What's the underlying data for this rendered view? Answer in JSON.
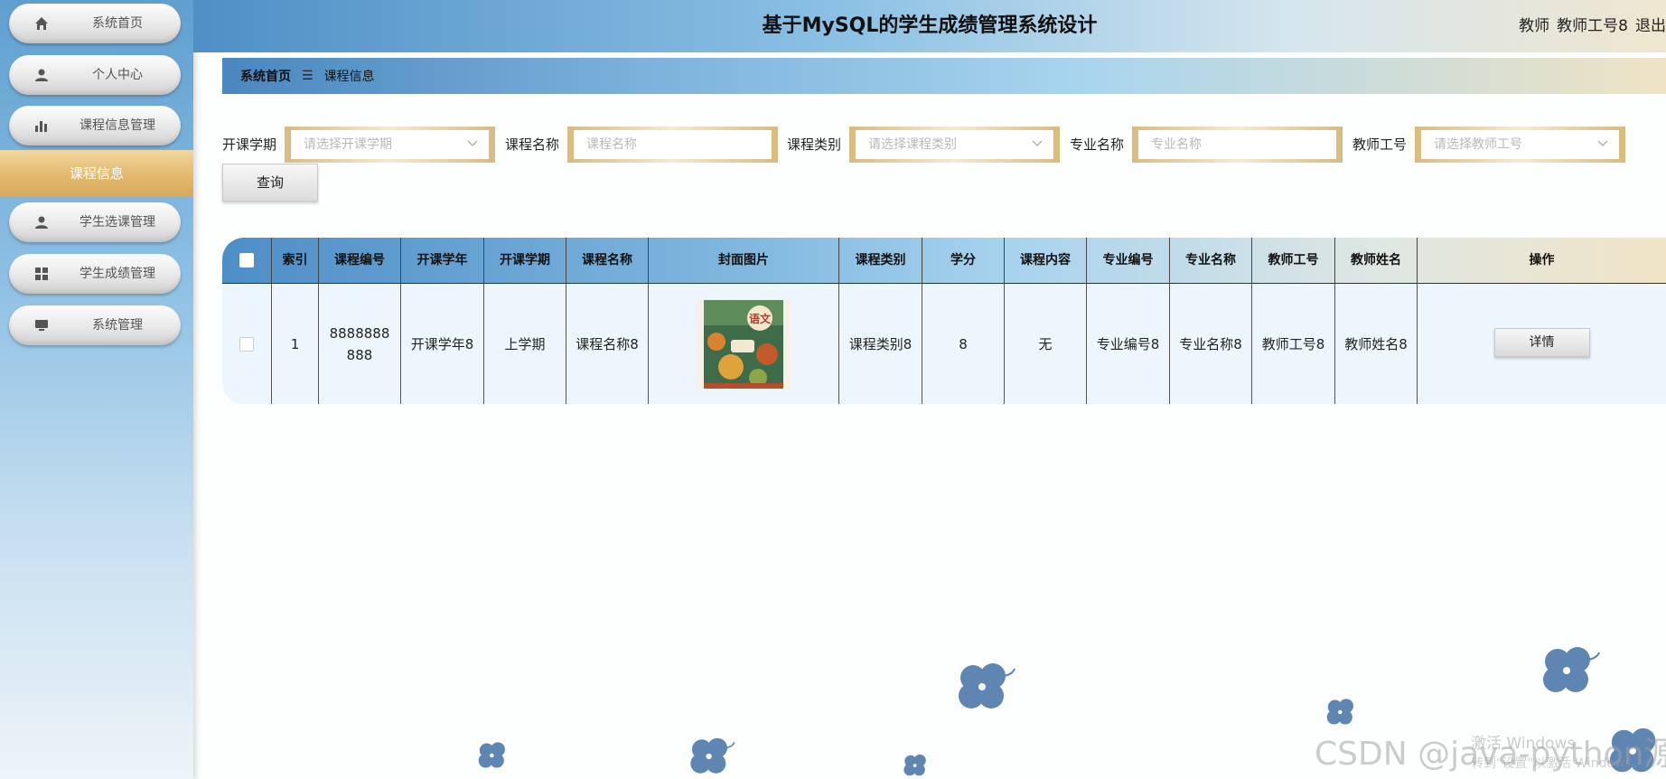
{
  "header": {
    "title": "基于MySQL的学生成绩管理系统设计",
    "role": "教师",
    "user": "教师工号8",
    "logout": "退出"
  },
  "sidebar": {
    "items": [
      {
        "label": "系统首页",
        "icon": "home-icon"
      },
      {
        "label": "个人中心",
        "icon": "user-icon"
      },
      {
        "label": "课程信息管理",
        "icon": "bar-chart-icon"
      },
      {
        "label": "课程信息",
        "icon": "",
        "active": true
      },
      {
        "label": "学生选课管理",
        "icon": "user-icon"
      },
      {
        "label": "学生成绩管理",
        "icon": "grid-icon"
      },
      {
        "label": "系统管理",
        "icon": "monitor-icon"
      }
    ]
  },
  "breadcrumb": {
    "home": "系统首页",
    "separator": "☰",
    "current": "课程信息"
  },
  "filters": [
    {
      "label": "开课学期",
      "placeholder": "请选择开课学期",
      "type": "select"
    },
    {
      "label": "课程名称",
      "placeholder": "课程名称",
      "type": "input"
    },
    {
      "label": "课程类别",
      "placeholder": "请选择课程类别",
      "type": "select"
    },
    {
      "label": "专业名称",
      "placeholder": "专业名称",
      "type": "input"
    },
    {
      "label": "教师工号",
      "placeholder": "请选择教师工号",
      "type": "select"
    }
  ],
  "query_button": "查询",
  "table": {
    "columns": [
      "",
      "索引",
      "课程编号",
      "开课学年",
      "开课学期",
      "课程名称",
      "封面图片",
      "课程类别",
      "学分",
      "课程内容",
      "专业编号",
      "专业名称",
      "教师工号",
      "教师姓名",
      "操作"
    ],
    "rows": [
      {
        "index": "1",
        "course_no": "8888888888",
        "year": "开课学年8",
        "term": "上学期",
        "course_name": "课程名称8",
        "cover_text": "语文",
        "category": "课程类别8",
        "credit": "8",
        "content": "无",
        "major_no": "专业编号8",
        "major_name": "专业名称8",
        "teacher_no": "教师工号8",
        "teacher_name": "教师姓名8",
        "action": "详情"
      }
    ]
  },
  "watermark": "CSDN @java-python源码",
  "activate_notice": "激活 Windows",
  "activate_sub": "转到\"设置\"以激活 Windows。",
  "colors": {
    "accent_blue": "#5f9fd0",
    "active_gold": "#e4bb72",
    "flower": "#5f86b2"
  }
}
